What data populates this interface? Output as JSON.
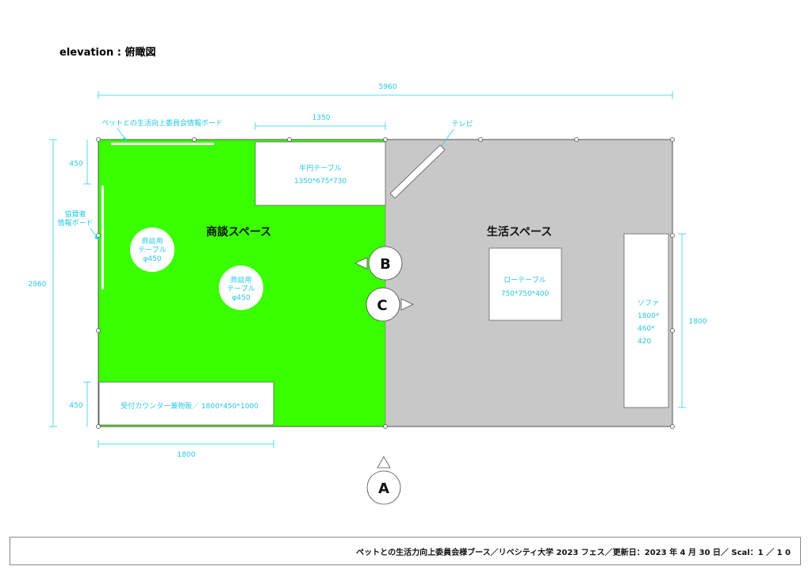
{
  "title": "elevation : 俯瞰図",
  "dimensions": {
    "overall_width": "5960",
    "overall_depth": "2960",
    "top_table_width": "1350",
    "top_left_depth": "450",
    "bottom_left_depth": "450",
    "counter_width": "1800",
    "sofa_length": "1800"
  },
  "callouts": {
    "top_board": "ペットとの生活向上委員会情報ボード",
    "side_board_line1": "協賛者",
    "side_board_line2": "情報ボード",
    "tv": "テレビ"
  },
  "zones": {
    "left": "商談スペース",
    "right": "生活スペース"
  },
  "furniture": {
    "half_table_name": "半円テーブル",
    "half_table_size": "1350*675*730",
    "round_table1_line1": "商談用",
    "round_table1_line2": "テーブル",
    "round_table1_line3": "φ450",
    "round_table2_line1": "商談用",
    "round_table2_line2": "テーブル",
    "round_table2_line3": "φ450",
    "counter": "受付カウンター兼物販／ 1800*450*1000",
    "low_table_name": "ローテーブル",
    "low_table_size": "750*750*400",
    "sofa_line1": "ソファ",
    "sofa_line2": "1800*",
    "sofa_line3": "460*",
    "sofa_line4": "420"
  },
  "markers": {
    "a": "A",
    "b": "B",
    "c": "C"
  },
  "colors": {
    "left_zone": "#39ff00",
    "right_zone": "#c8c8c8",
    "dimension": "#22d3e6"
  },
  "footer": "ペットとの生活力向上委員会様ブース／リベシティ大学 2023 フェス／更新日：2023 年 4 月 30 日／ Scal：1 ／ 1 0"
}
